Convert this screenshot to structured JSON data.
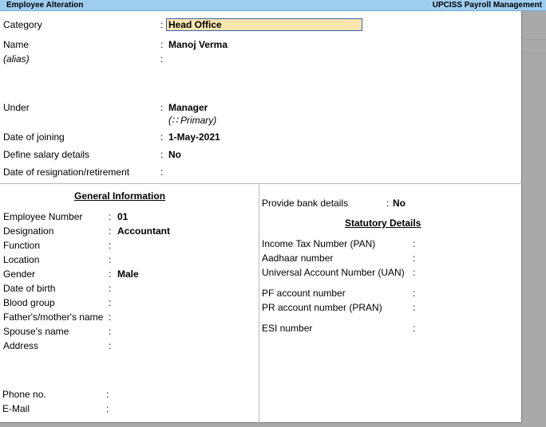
{
  "titlebar": {
    "left": "Employee  Alteration",
    "right": "UPCISS Payroll Management"
  },
  "top": {
    "category_label": "Category",
    "category_value": "Head Office",
    "name_label": "Name",
    "name_value": "Manoj Verma",
    "alias_label": "(alias)",
    "under_label": "Under",
    "under_value": "Manager",
    "under_sub": "(∷ Primary)",
    "doj_label": "Date of joining",
    "doj_value": "1-May-2021",
    "salary_label": "Define salary details",
    "salary_value": "No",
    "resign_label": "Date of resignation/retirement"
  },
  "general": {
    "heading": "General Information",
    "fields": [
      {
        "label": "Employee Number",
        "value": "01"
      },
      {
        "label": "Designation",
        "value": "Accountant"
      },
      {
        "label": "Function",
        "value": ""
      },
      {
        "label": "Location",
        "value": ""
      },
      {
        "label": "Gender",
        "value": "Male"
      },
      {
        "label": "Date of birth",
        "value": ""
      },
      {
        "label": "Blood group",
        "value": ""
      },
      {
        "label": "Father's/mother's name",
        "value": ""
      },
      {
        "label": "Spouse's name",
        "value": ""
      },
      {
        "label": "Address",
        "value": ""
      },
      {
        "label": "Phone no.",
        "value": ""
      },
      {
        "label": "E-Mail",
        "value": ""
      }
    ]
  },
  "bank": {
    "label": "Provide bank details",
    "value": "No"
  },
  "statutory": {
    "heading": "Statutory Details",
    "fields": [
      {
        "label": "Income Tax Number (PAN)"
      },
      {
        "label": "Aadhaar number"
      },
      {
        "label": "Universal Account Number (UAN)"
      },
      {
        "label": "PF account number"
      },
      {
        "label": "PR account number (PRAN)"
      },
      {
        "label": "ESI number"
      }
    ]
  },
  "colon": ":"
}
